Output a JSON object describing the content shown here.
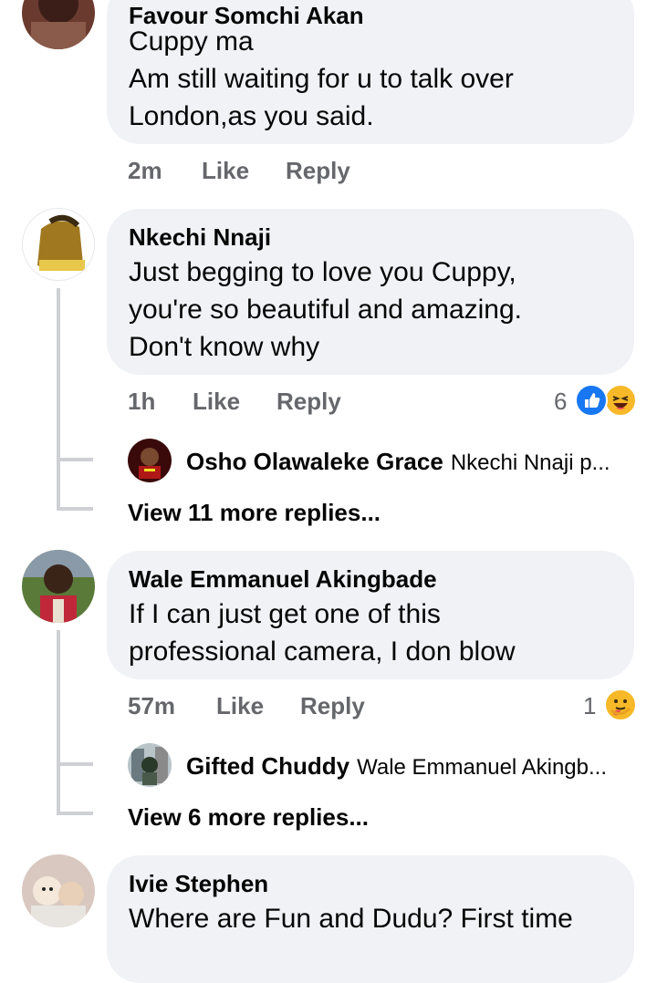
{
  "comments": [
    {
      "author": "Favour Somchi Akan",
      "lines": [
        "Cuppy ma",
        "Am still waiting for u to talk over",
        "London,as you said."
      ],
      "time": "2m",
      "like": "Like",
      "reply": "Reply"
    },
    {
      "author": "Nkechi Nnaji",
      "lines": [
        "Just begging to love you Cuppy,",
        "you're so beautiful and amazing.",
        "Don't know why"
      ],
      "time": "1h",
      "like": "Like",
      "reply": "Reply",
      "reaction_count": "6",
      "reactions": [
        "like-reaction-icon",
        "haha-reaction-icon"
      ],
      "latest_reply": {
        "author": "Osho Olawaleke Grace",
        "snippet": "Nkechi Nnaji p..."
      },
      "view_more": "View 11 more replies..."
    },
    {
      "author": "Wale Emmanuel Akingbade",
      "lines": [
        "If I can just get one of this",
        "professional camera, I don blow"
      ],
      "time": "57m",
      "like": "Like",
      "reply": "Reply",
      "reaction_count": "1",
      "reactions": [
        "care-reaction-icon"
      ],
      "latest_reply": {
        "author": "Gifted Chuddy",
        "snippet": "Wale Emmanuel Akingb..."
      },
      "view_more": "View 6 more replies..."
    },
    {
      "author": "Ivie Stephen",
      "lines": [
        "Where are Fun and Dudu? First time"
      ]
    }
  ],
  "colors": {
    "bubble": "#f0f2f5",
    "meta_text": "#65676b",
    "like_blue": "#1877f2",
    "haha_yellow": "#f7b928"
  }
}
